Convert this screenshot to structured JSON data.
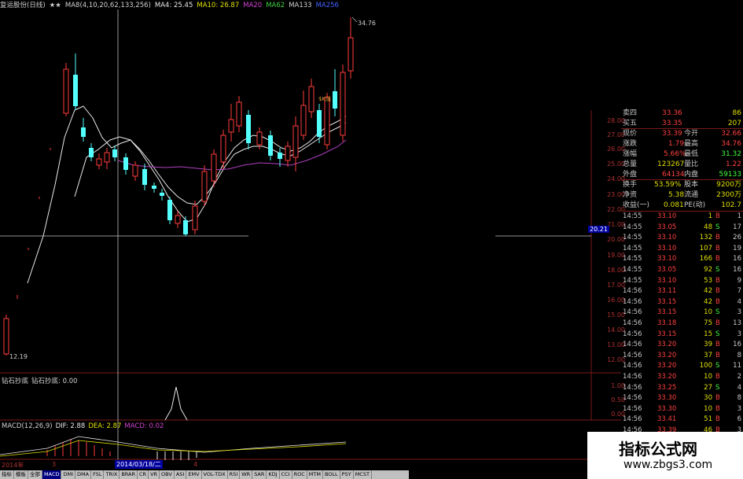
{
  "title_bar": {
    "stock_name": "复运股份(日线)",
    "stars": "★★",
    "ma_params": "MA8(4,10,20,62,133,256)",
    "ma4": "MA4: 25.45",
    "ma10": "MA10: 26.87",
    "ma20": "MA20",
    "ma62": "MA62",
    "ma133": "MA133",
    "ma256": "MA256"
  },
  "main_chart": {
    "high_label": "34.76",
    "low_label": "12.19",
    "mid_label": "$K涨",
    "price_axis": [
      "28.00",
      "27.00",
      "26.00",
      "25.00",
      "24.00",
      "23.00",
      "22.00",
      "21.00",
      "20.00",
      "19.00",
      "18.00",
      "17.00",
      "16.00",
      "15.00",
      "14.00",
      "13.00",
      "12.00"
    ],
    "crosshair_price": "20.21",
    "colors": {
      "up": "#ff3b3b",
      "down": "#54ffff",
      "ma_white": "#e8e8e8",
      "ma_purple": "#b040c0",
      "grid": "#7a1a1a"
    }
  },
  "indicator1": {
    "name": "钻石抄底",
    "label": "钻石抄底: 0.00",
    "axis": [
      "1.00",
      "0.50",
      "0.00"
    ]
  },
  "macd": {
    "params": "MACD(12,26,9)",
    "dif": "DIF: 2.88",
    "dea": "DEA: 2.87",
    "macd": "MACD: 0.02"
  },
  "bottom_dates": {
    "year": "2014年",
    "m3": "3",
    "m4": "4",
    "cursor_date": "2014/03/18/二"
  },
  "quote_panel": {
    "rows": [
      {
        "label": "卖四",
        "value": "33.36",
        "label2": "",
        "value2": "86"
      },
      {
        "label": "买五",
        "value": "33.35",
        "label2": "",
        "value2": "207"
      },
      {
        "label": "现价",
        "value": "33.39",
        "label2": "今开",
        "value2": "32.66"
      },
      {
        "label": "涨跌",
        "value": "1.79",
        "label2": "最高",
        "value2": "34.76"
      },
      {
        "label": "涨幅",
        "value": "5.66%",
        "label2": "最低",
        "value2": "31.32"
      },
      {
        "label": "总量",
        "value": "123267",
        "label2": "量比",
        "value2": "1.22"
      },
      {
        "label": "外盘",
        "value": "64134",
        "label2": "内盘",
        "value2": "59133"
      },
      {
        "label": "换手",
        "value": "53.59%",
        "label2": "股本",
        "value2": "9200万"
      },
      {
        "label": "净资",
        "value": "5.38",
        "label2": "流通",
        "value2": "2300万"
      },
      {
        "label": "收益(一)",
        "value": "0.081",
        "label2": "PE(动)",
        "value2": "102.7"
      }
    ],
    "ticks": [
      {
        "time": "14:55",
        "price": "33.10",
        "vol": "1",
        "side": "B",
        "n": "1"
      },
      {
        "time": "14:55",
        "price": "33.05",
        "vol": "48",
        "side": "S",
        "n": "17"
      },
      {
        "time": "14:55",
        "price": "33.10",
        "vol": "132",
        "side": "B",
        "n": "26"
      },
      {
        "time": "14:55",
        "price": "33.10",
        "vol": "107",
        "side": "B",
        "n": "19"
      },
      {
        "time": "14:55",
        "price": "33.10",
        "vol": "166",
        "side": "B",
        "n": "16"
      },
      {
        "time": "14:55",
        "price": "33.05",
        "vol": "92",
        "side": "S",
        "n": "16"
      },
      {
        "time": "14:55",
        "price": "33.10",
        "vol": "53",
        "side": "B",
        "n": "9"
      },
      {
        "time": "14:56",
        "price": "33.11",
        "vol": "42",
        "side": "B",
        "n": "7"
      },
      {
        "time": "14:56",
        "price": "33.15",
        "vol": "42",
        "side": "B",
        "n": "4"
      },
      {
        "time": "14:56",
        "price": "33.15",
        "vol": "10",
        "side": "S",
        "n": "3"
      },
      {
        "time": "14:56",
        "price": "33.18",
        "vol": "75",
        "side": "B",
        "n": "13"
      },
      {
        "time": "14:56",
        "price": "33.15",
        "vol": "15",
        "side": "S",
        "n": "3"
      },
      {
        "time": "14:56",
        "price": "33.20",
        "vol": "39",
        "side": "B",
        "n": "16"
      },
      {
        "time": "14:56",
        "price": "33.20",
        "vol": "37",
        "side": "B",
        "n": "8"
      },
      {
        "time": "14:56",
        "price": "33.20",
        "vol": "100",
        "side": "S",
        "n": "11"
      },
      {
        "time": "14:56",
        "price": "33.20",
        "vol": "10",
        "side": "B",
        "n": "2"
      },
      {
        "time": "14:56",
        "price": "33.25",
        "vol": "27",
        "side": "S",
        "n": "4"
      },
      {
        "time": "14:56",
        "price": "33.30",
        "vol": "30",
        "side": "B",
        "n": "8"
      },
      {
        "time": "14:56",
        "price": "33.30",
        "vol": "10",
        "side": "B",
        "n": "3"
      },
      {
        "time": "14:56",
        "price": "33.41",
        "vol": "51",
        "side": "B",
        "n": "6"
      },
      {
        "time": "14:56",
        "price": "33.39",
        "vol": "46",
        "side": "B",
        "n": "3"
      }
    ]
  },
  "tabs": [
    "指标",
    "模板",
    "全部",
    "MACD",
    "DMI",
    "DMA",
    "FSL",
    "TRIX",
    "BRAR",
    "CR",
    "VR",
    "OBV",
    "ASI",
    "EMV",
    "VOL-TDX",
    "RSI",
    "WR",
    "SAR",
    "KDJ",
    "CCI",
    "ROC",
    "MTM",
    "BOLL",
    "PSY",
    "MCST"
  ],
  "watermark": {
    "line1": "指标公式网",
    "line2": "www.zbgs3.com"
  }
}
